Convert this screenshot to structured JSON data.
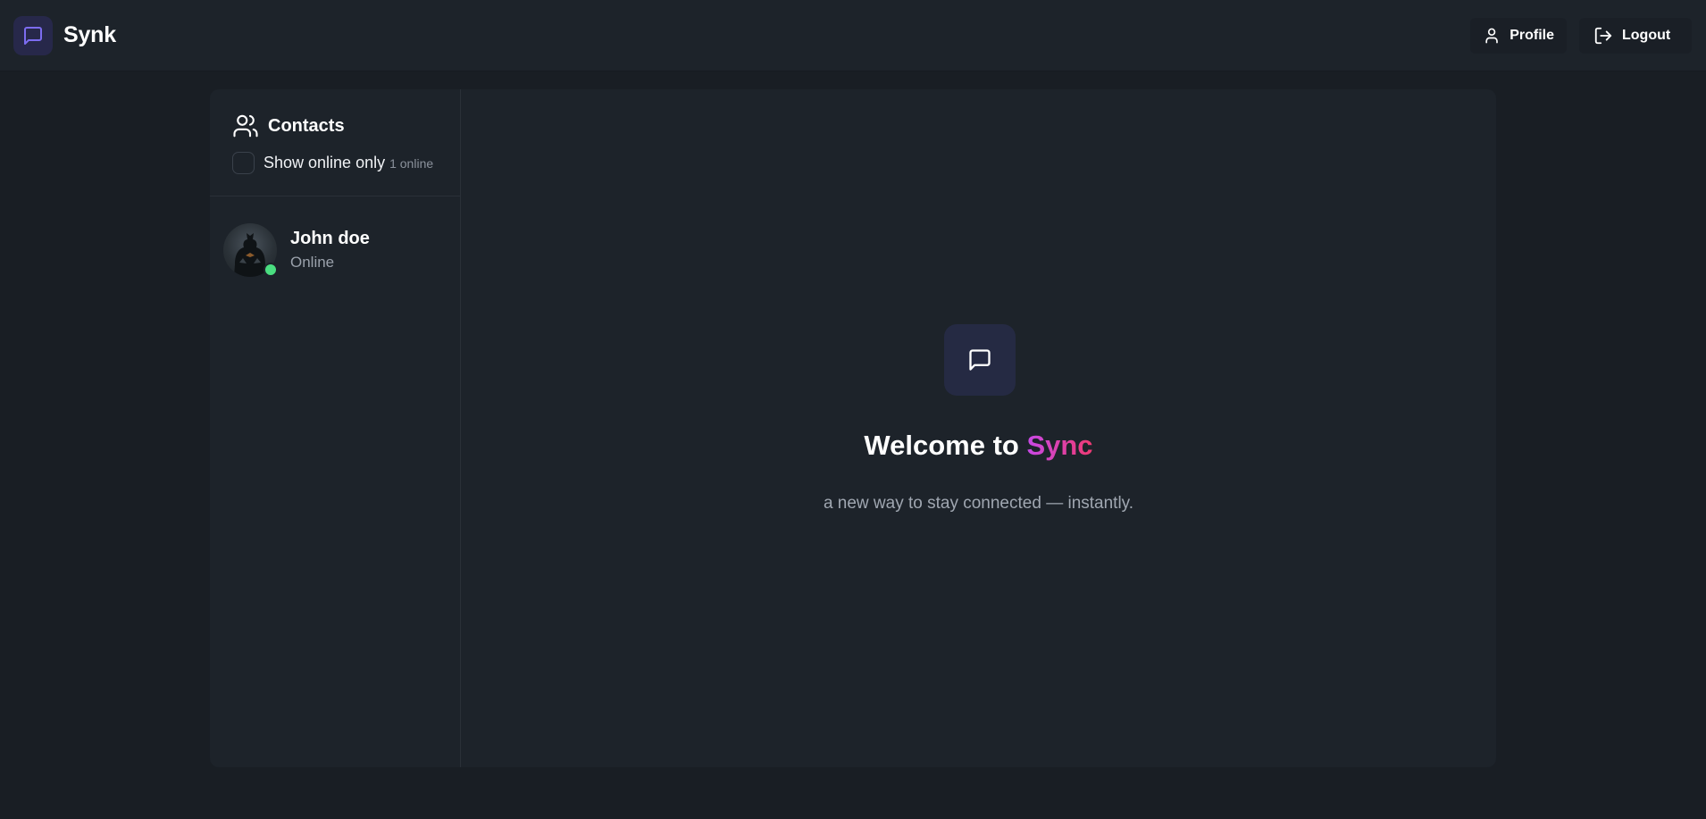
{
  "app": {
    "name": "Synk"
  },
  "nav": {
    "profile_label": "Profile",
    "logout_label": "Logout"
  },
  "sidebar": {
    "title": "Contacts",
    "filter_label": "Show online only",
    "online_count": "1 online",
    "contacts": [
      {
        "name": "John doe",
        "status": "Online",
        "is_online": true
      }
    ]
  },
  "welcome": {
    "title_prefix": "Welcome to ",
    "title_accent": "Sync",
    "subtitle": "a new way to stay connected — instantly."
  },
  "icons": {
    "brand": "message-square-icon",
    "profile": "user-icon",
    "logout": "log-out-icon",
    "contacts": "users-icon",
    "welcome": "message-square-icon"
  },
  "colors": {
    "accent_gradient_start": "#c849e8",
    "accent_gradient_end": "#ef3a71",
    "brand_icon": "#7c6cf0",
    "online": "#4ade80"
  }
}
